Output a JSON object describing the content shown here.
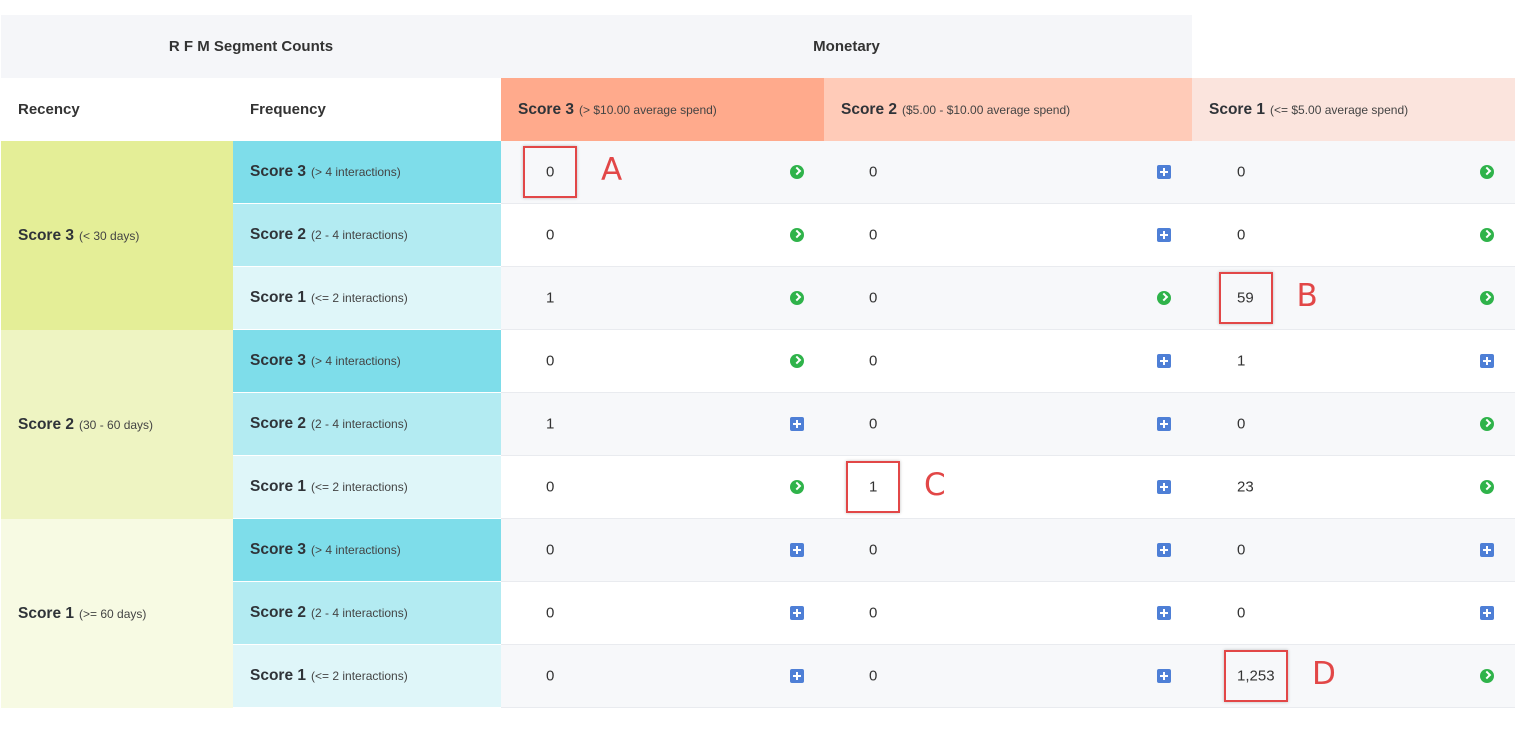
{
  "title": "R F M Segment Counts",
  "monetary_label": "Monetary",
  "recency_label": "Recency",
  "frequency_label": "Frequency",
  "monetary_headers": [
    {
      "score": "Score 3",
      "desc": "(> $10.00 average spend)"
    },
    {
      "score": "Score 2",
      "desc": "($5.00 - $10.00 average spend)"
    },
    {
      "score": "Score 1",
      "desc": "(<= $5.00 average spend)"
    }
  ],
  "recency": [
    {
      "score": "Score 3",
      "desc": "(< 30 days)"
    },
    {
      "score": "Score 2",
      "desc": "(30 - 60 days)"
    },
    {
      "score": "Score 1",
      "desc": "(>= 60 days)"
    }
  ],
  "frequency": [
    {
      "score": "Score 3",
      "desc": "(> 4 interactions)"
    },
    {
      "score": "Score 2",
      "desc": "(2 - 4 interactions)"
    },
    {
      "score": "Score 1",
      "desc": "(<= 2 interactions)"
    }
  ],
  "rows": [
    {
      "values": [
        "0",
        "0",
        "0"
      ],
      "icons": [
        "go-icon",
        "plus-icon",
        "go-icon"
      ]
    },
    {
      "values": [
        "0",
        "0",
        "0"
      ],
      "icons": [
        "go-icon",
        "plus-icon",
        "go-icon"
      ]
    },
    {
      "values": [
        "1",
        "0",
        "59"
      ],
      "icons": [
        "go-icon",
        "go-icon",
        "go-icon"
      ]
    },
    {
      "values": [
        "0",
        "0",
        "1"
      ],
      "icons": [
        "go-icon",
        "plus-icon",
        "plus-icon"
      ]
    },
    {
      "values": [
        "1",
        "0",
        "0"
      ],
      "icons": [
        "plus-icon",
        "plus-icon",
        "go-icon"
      ]
    },
    {
      "values": [
        "0",
        "1",
        "23"
      ],
      "icons": [
        "go-icon",
        "plus-icon",
        "go-icon"
      ]
    },
    {
      "values": [
        "0",
        "0",
        "0"
      ],
      "icons": [
        "plus-icon",
        "plus-icon",
        "plus-icon"
      ]
    },
    {
      "values": [
        "0",
        "0",
        "0"
      ],
      "icons": [
        "plus-icon",
        "plus-icon",
        "plus-icon"
      ]
    },
    {
      "values": [
        "0",
        "0",
        "1,253"
      ],
      "icons": [
        "plus-icon",
        "plus-icon",
        "go-icon"
      ]
    }
  ],
  "annotations": [
    {
      "letter": "A",
      "row": 0,
      "col": 0
    },
    {
      "letter": "B",
      "row": 2,
      "col": 2
    },
    {
      "letter": "C",
      "row": 5,
      "col": 1
    },
    {
      "letter": "D",
      "row": 8,
      "col": 2
    }
  ],
  "colors": {
    "monetary_score3": "#ffaa8c",
    "monetary_score2": "#ffcbb8",
    "monetary_score1": "#fbe4dd",
    "recency_score3": "#e4ee97",
    "recency_score2": "#eef4c2",
    "recency_score1": "#f7fae3",
    "frequency_score3": "#7eddea",
    "frequency_score2": "#b3ebf2",
    "frequency_score1": "#dff6f9",
    "go_icon": "#2fb34a",
    "plus_icon": "#4e7fd6",
    "annotation": "#e24747"
  }
}
